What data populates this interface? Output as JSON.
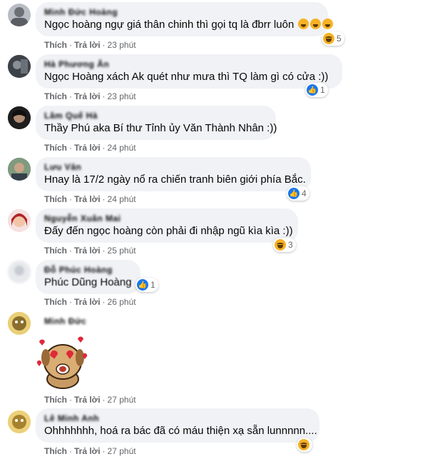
{
  "actions": {
    "like_label": "Thích",
    "reply_label": "Trả lời",
    "separator": "·"
  },
  "comments": [
    {
      "name": "Minh Đức Hoàng",
      "text": "Ngọc hoàng ngự giá thân chinh thì gọi tq là đbrr luôn",
      "time": "23 phút",
      "reaction": "haha",
      "reaction_count": "5"
    },
    {
      "name": "Hà Phương Ân",
      "text": "Ngọc Hoàng xách Ak quét như mưa thì TQ làm gì có cửa :))",
      "time": "23 phút",
      "reaction": "like",
      "reaction_count": "1"
    },
    {
      "name": "Lâm Quế Hà",
      "text": "Thầy Phú aka Bí thư Tỉnh ủy Văn Thành Nhân :))",
      "time": "24 phút",
      "reaction": "",
      "reaction_count": ""
    },
    {
      "name": "Lưu Văn",
      "text": "Hnay là 17/2 ngày nổ ra chiến tranh biên giới phía Bắc.",
      "time": "24 phút",
      "reaction": "like",
      "reaction_count": "4"
    },
    {
      "name": "Nguyễn Xuân Mai",
      "text": "Đấy đến ngọc hoàng còn phải đi nhập ngũ kìa kìa :))",
      "time": "25 phút",
      "reaction": "haha",
      "reaction_count": "3"
    },
    {
      "name": "Đỗ Phúc Hoàng",
      "text": "Phúc Dũng Hoàng",
      "time": "26 phút",
      "reaction": "like",
      "reaction_count": "1"
    },
    {
      "name": "Minh Đức",
      "text": "",
      "time": "27 phút",
      "reaction": "",
      "reaction_count": ""
    },
    {
      "name": "Lê Minh Anh",
      "text": "Ohhhhhhh, hoá ra bác đã có máu thiện xạ sẵn lunnnnn....",
      "time": "27 phút",
      "reaction": "haha",
      "reaction_count": ""
    }
  ],
  "colors": {
    "bubble": "#f0f2f5",
    "meta": "#65676b",
    "like": "#1877f2",
    "haha": "#f7b125"
  }
}
